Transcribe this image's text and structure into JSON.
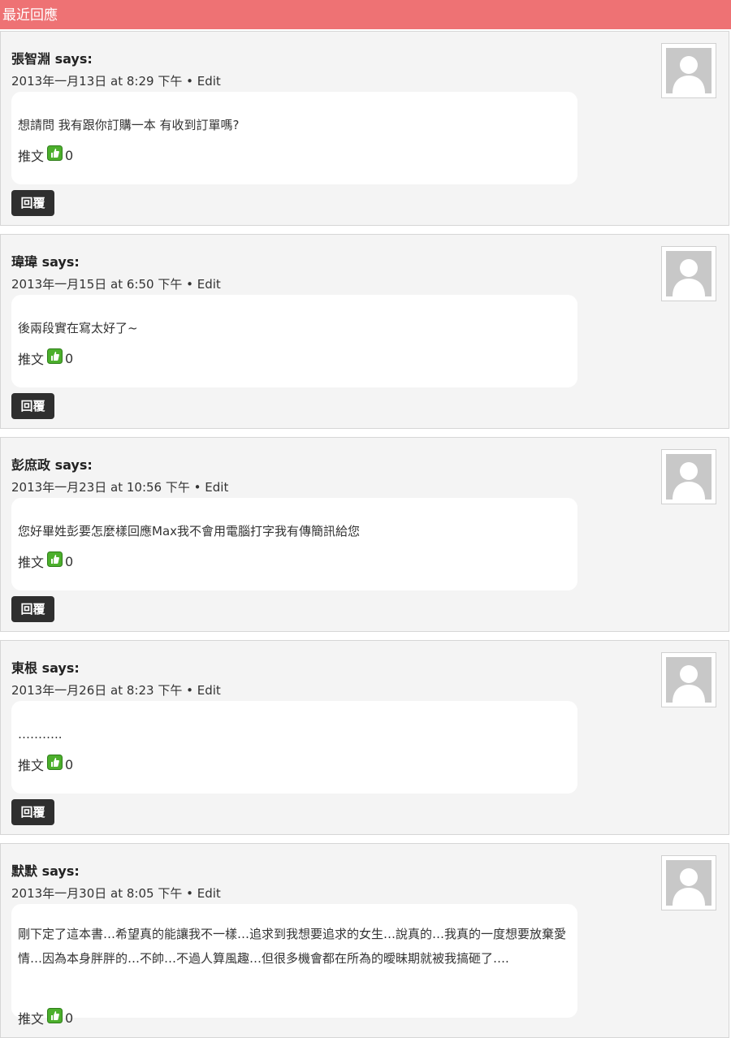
{
  "section": {
    "title": "最近回應"
  },
  "labels": {
    "says": "says:",
    "edit": "Edit",
    "separator": "•",
    "push": "推文",
    "reply": "回覆"
  },
  "comments": [
    {
      "author": "張智淵",
      "date": "2013年一月13日 at 8:29 下午",
      "text": "想請問 我有跟你訂購一本 有收到訂單嗎?",
      "likes": "0"
    },
    {
      "author": "瑋瑋",
      "date": "2013年一月15日 at 6:50 下午",
      "text": "後兩段實在寫太好了~",
      "likes": "0"
    },
    {
      "author": "彭庶政",
      "date": "2013年一月23日 at 10:56 下午",
      "text": "您好畢姓彭要怎麼樣回應Max我不會用電腦打字我有傳簡訊給您",
      "likes": "0"
    },
    {
      "author": "東根",
      "date": "2013年一月26日 at 8:23 下午",
      "text": "………..",
      "likes": "0"
    },
    {
      "author": "默默",
      "date": "2013年一月30日 at 8:05 下午",
      "text": "剛下定了這本書…希望真的能讓我不一樣…追求到我想要追求的女生…說真的…我真的一度想要放棄愛情…因為本身胖胖的…不帥…不過人算風趣…但很多機會都在所為的曖昧期就被我搞砸了….",
      "likes": "0"
    }
  ],
  "colors": {
    "header": "#ee7274",
    "card": "#f4f4f4",
    "like_icon": "#4caf2c",
    "reply_button": "#2f2f2f"
  }
}
